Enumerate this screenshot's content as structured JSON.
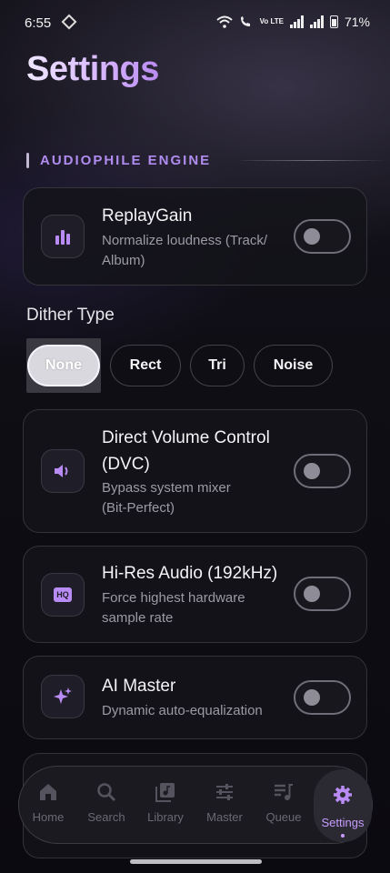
{
  "status_bar": {
    "time": "6:55",
    "battery": "71%",
    "network_label": "Vo LTE"
  },
  "page": {
    "title": "Settings"
  },
  "section": {
    "label": "AUDIOPHILE ENGINE"
  },
  "replaygain": {
    "title": "ReplayGain",
    "desc_line1": "Normalize loudness (Track/",
    "desc_line2": "Album)",
    "enabled": false
  },
  "dither": {
    "label": "Dither Type",
    "options": [
      "None",
      "Rect",
      "Tri",
      "Noise"
    ],
    "selected": "None"
  },
  "dvc": {
    "title_line1": "Direct Volume Control",
    "title_line2": "(DVC)",
    "desc_line1": "Bypass system mixer",
    "desc_line2": "(Bit-Perfect)",
    "enabled": false
  },
  "hires": {
    "title": "Hi-Res Audio (192kHz)",
    "desc_line1": "Force highest hardware",
    "desc_line2": "sample rate",
    "enabled": false,
    "icon_text": "HQ"
  },
  "ai_master": {
    "title": "AI Master",
    "desc": "Dynamic auto-equalization",
    "enabled": false
  },
  "nav": {
    "items": [
      {
        "label": "Home",
        "icon": "home-icon"
      },
      {
        "label": "Search",
        "icon": "search-icon"
      },
      {
        "label": "Library",
        "icon": "library-icon"
      },
      {
        "label": "Master",
        "icon": "sliders-icon"
      },
      {
        "label": "Queue",
        "icon": "queue-icon"
      },
      {
        "label": "Settings",
        "icon": "gear-icon"
      }
    ],
    "active": "Settings"
  },
  "colors": {
    "accent": "#b08cf0",
    "active_nav": "#c79dff",
    "background": "#0f0e15"
  }
}
